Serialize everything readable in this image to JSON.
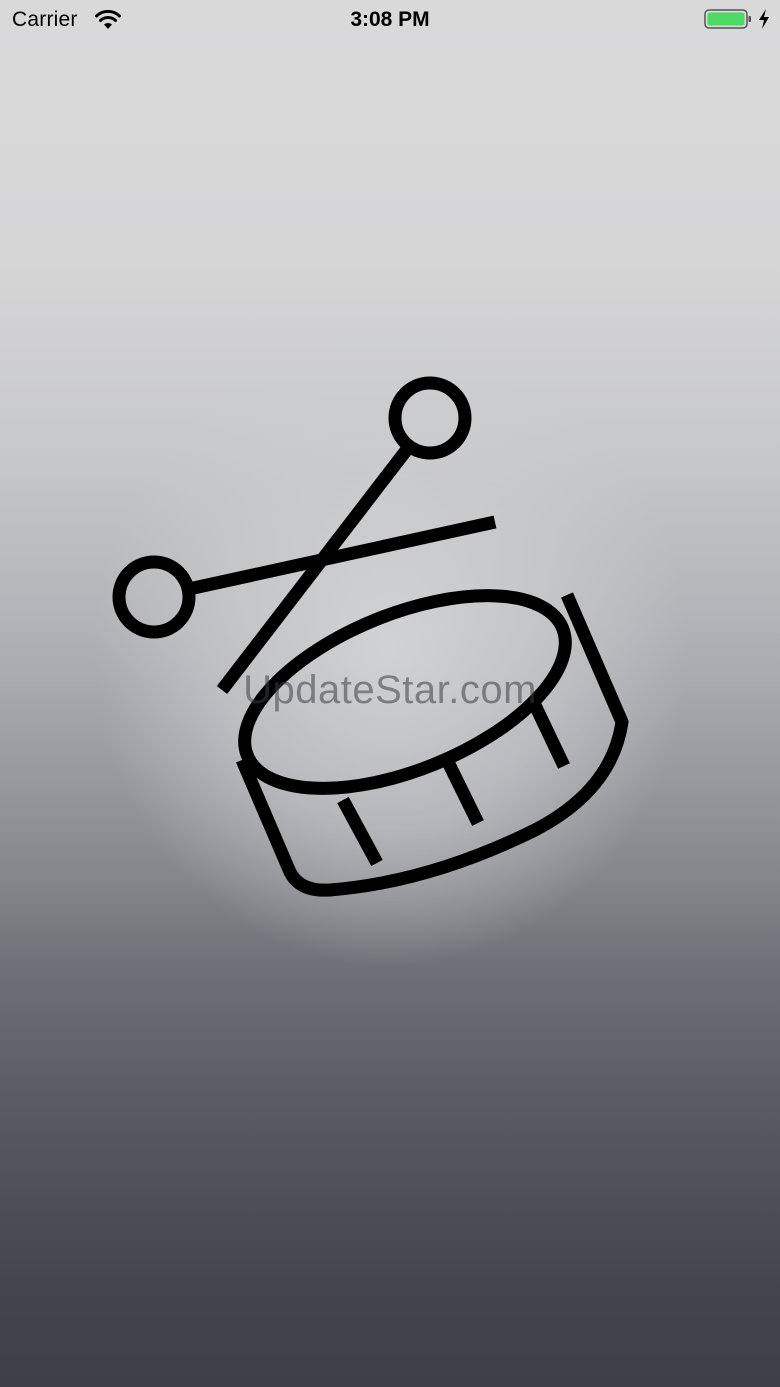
{
  "status_bar": {
    "carrier": "Carrier",
    "time": "3:08 PM",
    "battery_color": "#4cd964"
  },
  "splash": {
    "icon": "drum-with-sticks-icon",
    "watermark": "UpdateStar.com"
  }
}
